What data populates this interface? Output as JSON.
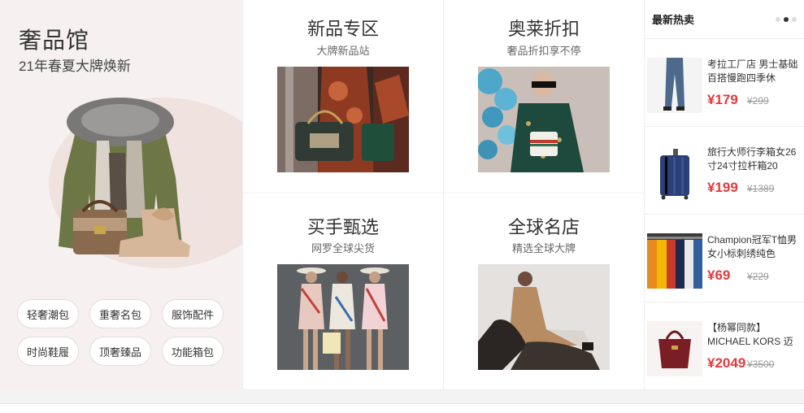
{
  "promo": {
    "title": "奢品馆",
    "subtitle": "21年春夏大牌焕新",
    "tags": [
      "轻奢潮包",
      "重奢名包",
      "服饰配件",
      "时尚鞋履",
      "顶奢臻品",
      "功能箱包"
    ]
  },
  "sections": [
    {
      "title": "新品专区",
      "subtitle": "大牌新品站",
      "image": "new-arrivals-photo"
    },
    {
      "title": "奥莱折扣",
      "subtitle": "奢品折扣享不停",
      "image": "outlet-discount-photo"
    },
    {
      "title": "买手甄选",
      "subtitle": "网罗全球尖货",
      "image": "buyer-picks-photo"
    },
    {
      "title": "全球名店",
      "subtitle": "精选全球大牌",
      "image": "global-stores-photo"
    }
  ],
  "hot": {
    "title": "最新热卖",
    "items": [
      {
        "name": "考拉工厂店 男士基础百搭慢跑四季休",
        "price": "¥179",
        "old_price": "¥299",
        "image": "jeans-photo"
      },
      {
        "name": "旅行大师行李箱女26寸24寸拉杆箱20",
        "price": "¥199",
        "old_price": "¥1389",
        "image": "suitcase-photo"
      },
      {
        "name": "Champion冠军T恤男女小标刺绣纯色",
        "price": "¥69",
        "old_price": "¥229",
        "image": "tshirts-photo"
      },
      {
        "name": "【杨幂同款】MICHAEL KORS 迈",
        "price": "¥2049",
        "old_price": "¥3500",
        "image": "handbag-photo"
      }
    ]
  },
  "colors": {
    "price": "#e4393c",
    "promo_bg": "#f6f1f0"
  }
}
